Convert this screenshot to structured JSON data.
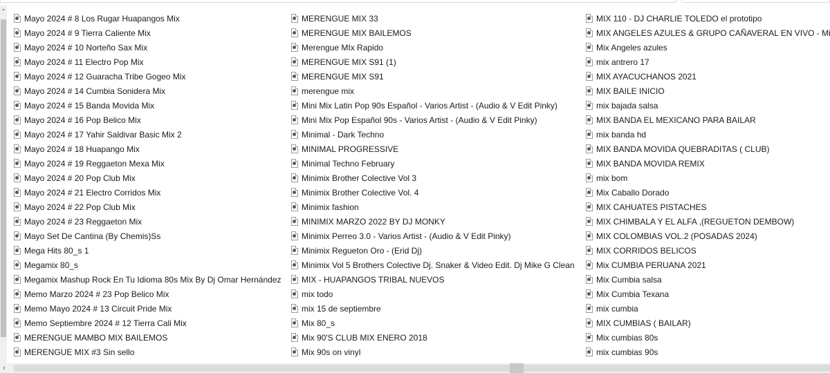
{
  "columns": [
    {
      "items": [
        "Mayo 2024 # 8 Los Rugar Huapangos Mix",
        "Mayo 2024 # 9 Tierra Caliente Mix",
        "Mayo 2024 # 10 Norteño Sax Mix",
        "Mayo 2024 # 11 Electro Pop Mix",
        "Mayo 2024 # 12 Guaracha Tribe Gogeo Mix",
        "Mayo 2024 # 14 Cumbia Sonidera Mix",
        "Mayo 2024 # 15 Banda Movida Mix",
        "Mayo 2024 # 16 Pop Belico Mix",
        "Mayo 2024 # 17 Yahir Saldivar Basic Mix 2",
        "Mayo 2024 # 18 Huapango Mix",
        "Mayo 2024 # 19 Reggaeton Mexa Mix",
        "Mayo 2024 # 20 Pop Club Mix",
        "Mayo 2024 # 21 Electro Corridos Mix",
        "Mayo 2024 # 22 Pop Club Mix",
        "Mayo 2024 # 23 Reggaeton Mix",
        "Mayo Set De Cantina (By Chemis)Ss",
        "Mega Hits 80_s 1",
        "Megamix 80_s",
        "Megamix Mashup Rock En Tu Idioma 80s Mix By Dj Omar Hernández",
        "Memo Marzo 2024 # 23 Pop Belico Mix",
        "Memo Mayo 2024 # 13 Circuit Pride Mix",
        "Memo Septiembre  2024 # 12 Tierra Cali Mix",
        "MERENGUE MAMBO MIX BAILEMOS",
        "MERENGUE MIX #3 Sin sello"
      ]
    },
    {
      "items": [
        "MERENGUE MIX 33",
        "MERENGUE MIX BAILEMOS",
        "Merengue MIx Rapido",
        "MERENGUE MIX S91 (1)",
        "MERENGUE MIX S91",
        "merengue mix",
        "Mini Mix Latin Pop 90s Español - Varios Artist  - (Audio & V Edit Pinky)",
        "Mini Mix Pop Español 90s - Varios Artist  - (Audio & V Edit Pinky)",
        "Minimal - Dark Techno",
        "MINIMAL PROGRESSIVE",
        "Minimal Techno February",
        "Minimix Brother Colective Vol 3",
        "Minimix Brother Colective Vol. 4",
        "Minimix fashion",
        "MINIMIX MARZO 2022 BY DJ MONKY",
        "Minimix Perreo 3.0 - Varios Artist  - (Audio & V Edit Pinky)",
        "Minimix Regueton Oro - (Erid Dj)",
        "Minimix Vol 5  Brothers Colective Dj. Snaker & Video Edit. Dj Mike G Clean",
        "MIX - HUAPANGOS TRIBAL NUEVOS",
        "mix  todo",
        "mix 15 de septiembre",
        "Mix 80_s",
        "Mix 90'S CLUB MIX ENERO 2018",
        "Mix 90s on vinyl"
      ]
    },
    {
      "items": [
        "MIX 110 - DJ CHARLIE TOLEDO el prototipo",
        "MIX ANGELES AZULES & GRUPO CAÑAVERAL EN VIVO - Mixer Z",
        "Mix Angeles azules",
        "mix antrero 17",
        "MIX AYACUCHANOS 2021",
        "MIX BAILE INICIO",
        "mix bajada salsa",
        "MIX BANDA EL MEXICANO PARA BAILAR",
        "mix banda hd",
        "MIX BANDA MOVIDA QUEBRADITAS ( CLUB)",
        "MIX BANDA MOVIDA REMIX",
        "mix bom",
        "Mix Caballo Dorado",
        "MIX CAHUATES PISTACHES",
        "MIX CHIMBALA Y EL ALFA ,(REGUETON DEMBOW)",
        "MIX COLOMBIAS VOL.2 (POSADAS 2024)",
        "MIX CORRIDOS BELICOS",
        "Mix CUMBIA PERUANA 2021",
        "Mix Cumbia salsa",
        "Mix Cumbia Texana",
        "mix cumbia",
        "MIX CUMBIAS ( BAILAR)",
        "Mix cumbias 80s",
        "mix cumbias 90s"
      ]
    }
  ],
  "icons": {
    "file": "video-file-icon",
    "scroll_up": "chevron-up-icon",
    "scroll_left": "chevron-left-icon"
  },
  "colors": {
    "background": "#ffffff",
    "scrollbar_track": "#f0f0f0",
    "scrollbar_thumb": "#c1c1c1"
  }
}
